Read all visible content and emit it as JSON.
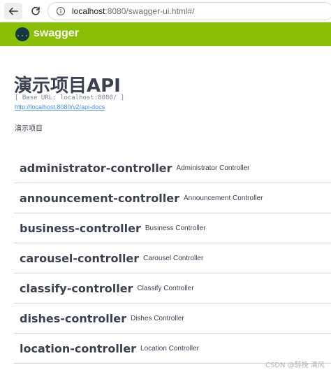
{
  "browser": {
    "url_host": "localhost",
    "url_rest": ":8080/swagger-ui.html#/"
  },
  "topbar": {
    "logo_glyph": "{...}",
    "logo_text": "swagger",
    "color": "#89bf04"
  },
  "info": {
    "title": "演示项目API",
    "base_url": "[ Base URL: localhost:8080/ ]",
    "docs_link": "http://localhost:8080/v2/api-docs",
    "description": "演示项目"
  },
  "controllers": [
    {
      "name": "administrator-controller",
      "description": "Administrator Controller"
    },
    {
      "name": "announcement-controller",
      "description": "Announcement Controller"
    },
    {
      "name": "business-controller",
      "description": "Business Controller"
    },
    {
      "name": "carousel-controller",
      "description": "Carousel Controller"
    },
    {
      "name": "classify-controller",
      "description": "Classify Controller"
    },
    {
      "name": "dishes-controller",
      "description": "Dishes Controller"
    },
    {
      "name": "location-controller",
      "description": "Location Controller"
    }
  ],
  "watermark": "CSDN @醉挽 清风"
}
